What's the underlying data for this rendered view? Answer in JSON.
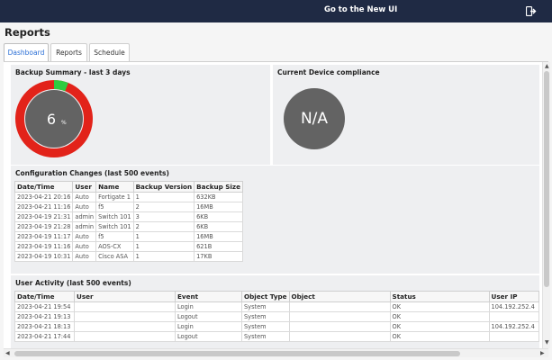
{
  "topbar": {
    "new_ui_label": "Go to the New UI",
    "exit_icon": "exit-icon"
  },
  "page": {
    "title": "Reports"
  },
  "tabs": [
    {
      "label": "Dashboard",
      "active": true
    },
    {
      "label": "Reports",
      "active": false
    },
    {
      "label": "Schedule",
      "active": false
    }
  ],
  "backup_summary": {
    "title": "Backup Summary - last 3 days",
    "value": "6",
    "unit": "%",
    "success_fraction": 0.06,
    "colors": {
      "fail": "#e2231a",
      "success": "#2ecc40",
      "center": "#636363"
    }
  },
  "compliance": {
    "title": "Current Device compliance",
    "value": "N/A"
  },
  "config_changes": {
    "title": "Configuration Changes (last 500 events)",
    "columns": [
      "Date/Time",
      "User",
      "Name",
      "Backup Version",
      "Backup Size"
    ],
    "rows": [
      [
        "2023-04-21 20:16",
        "Auto",
        "Fortigate 1",
        "1",
        "632KB"
      ],
      [
        "2023-04-21 11:16",
        "Auto",
        "f5",
        "2",
        "16MB"
      ],
      [
        "2023-04-19 21:31",
        "admin",
        "Switch 101",
        "3",
        "6KB"
      ],
      [
        "2023-04-19 21:28",
        "admin",
        "Switch 101",
        "2",
        "6KB"
      ],
      [
        "2023-04-19 11:17",
        "Auto",
        "f5",
        "1",
        "16MB"
      ],
      [
        "2023-04-19 11:16",
        "Auto",
        "AOS-CX",
        "1",
        "621B"
      ],
      [
        "2023-04-19 10:31",
        "Auto",
        "Cisco ASA",
        "1",
        "17KB"
      ]
    ]
  },
  "user_activity": {
    "title": "User Activity (last 500 events)",
    "columns": [
      "Date/Time",
      "User",
      "Event",
      "Object Type",
      "Object",
      "Status",
      "User IP"
    ],
    "rows": [
      [
        "2023-04-21 19:54",
        "",
        "Login",
        "System",
        "",
        "OK",
        "104.192.252.4"
      ],
      [
        "2023-04-21 19:13",
        "",
        "Logout",
        "System",
        "",
        "OK",
        ""
      ],
      [
        "2023-04-21 18:13",
        "",
        "Login",
        "System",
        "",
        "OK",
        "104.192.252.4"
      ],
      [
        "2023-04-21 17:44",
        "",
        "Logout",
        "System",
        "",
        "OK",
        ""
      ]
    ]
  }
}
